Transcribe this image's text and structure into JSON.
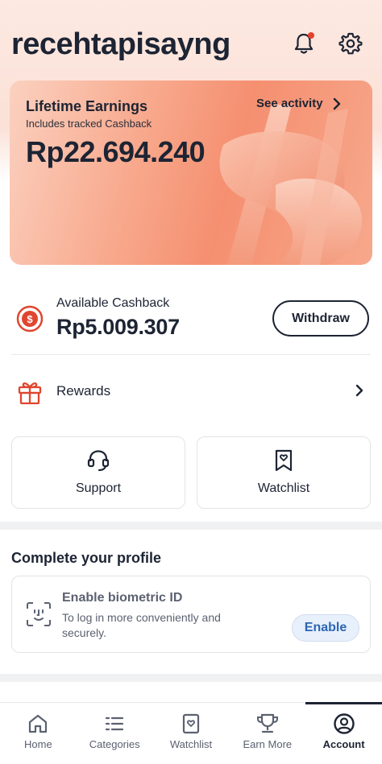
{
  "header": {
    "username": "recehtapisayng",
    "has_notification": true,
    "notification_dot_color": "#e5412b"
  },
  "earnings": {
    "title": "Lifetime Earnings",
    "subtitle": "Includes tracked Cashback",
    "amount": "Rp22.694.240",
    "see_activity_label": "See activity"
  },
  "cashback": {
    "label": "Available Cashback",
    "amount": "Rp5.009.307",
    "withdraw_label": "Withdraw",
    "icon": "coin-icon"
  },
  "rewards": {
    "label": "Rewards",
    "icon": "gift-icon"
  },
  "tiles": {
    "support_label": "Support",
    "watchlist_label": "Watchlist"
  },
  "profile": {
    "section_title": "Complete your profile",
    "biometric_title": "Enable biometric ID",
    "biometric_desc": "To log in more conveniently and securely.",
    "enable_label": "Enable"
  },
  "nav": {
    "items": [
      {
        "label": "Home",
        "icon": "home-icon"
      },
      {
        "label": "Categories",
        "icon": "list-icon"
      },
      {
        "label": "Watchlist",
        "icon": "watchlist-icon"
      },
      {
        "label": "Earn More",
        "icon": "trophy-icon"
      },
      {
        "label": "Account",
        "icon": "account-icon"
      }
    ],
    "active": "Account"
  },
  "colors": {
    "accent_text": "#1d2433",
    "card_gradient_start": "#fbd1c0",
    "card_gradient_end": "#f58f70",
    "coin_red": "#e0452f",
    "enable_blue": "#2b66b3"
  }
}
